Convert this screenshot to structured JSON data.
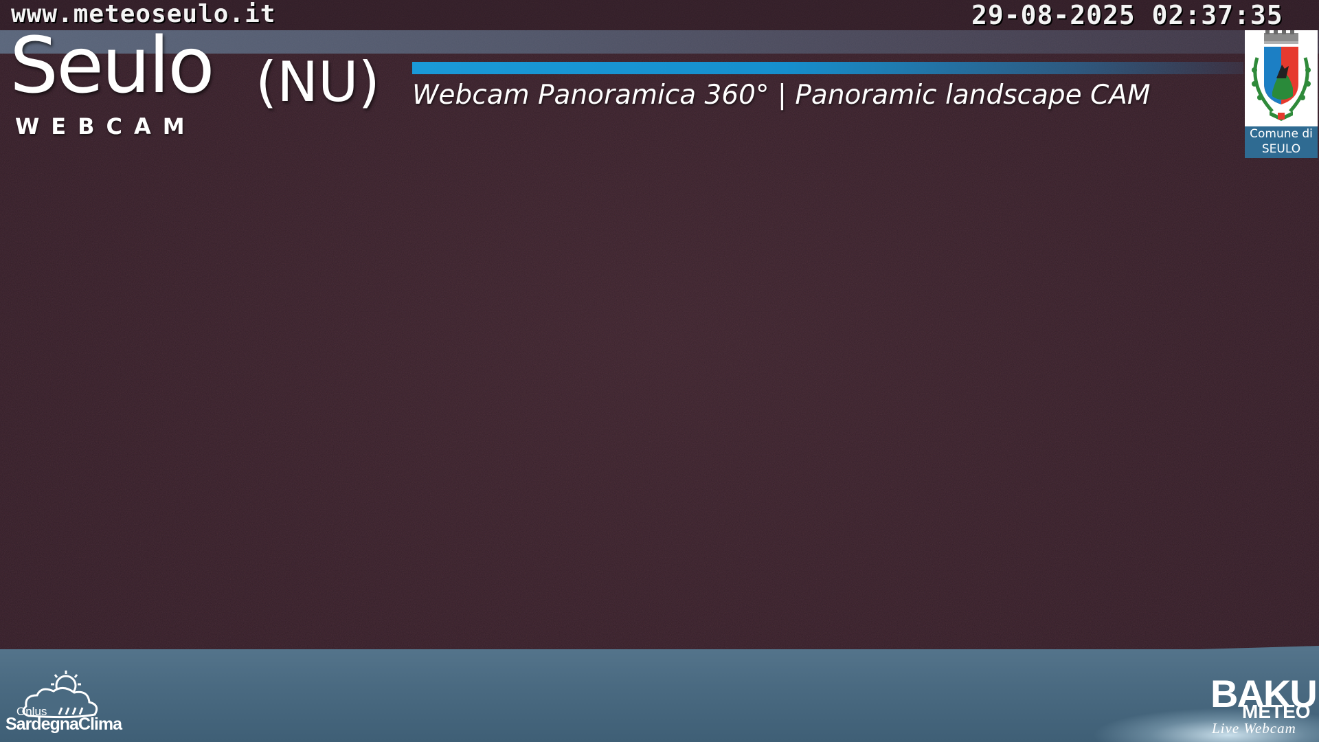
{
  "overlay": {
    "url": "www.meteoseulo.it",
    "timestamp": "29-08-2025 02:37:35",
    "town": "Seulo",
    "province": "(NU)",
    "label": "WEBCAM",
    "subtitle": "Webcam Panoramica 360°  |  Panoramic landscape CAM"
  },
  "crest": {
    "caption_line1": "Comune di",
    "caption_line2": "SEULO"
  },
  "logos": {
    "left": {
      "tag": "Onlus",
      "name": "SardegnaClima"
    },
    "right": {
      "main": "BAKU",
      "sub": "METEO",
      "tag": "Live Webcam"
    }
  },
  "colors": {
    "sky": "#352029",
    "accent_bar": "#1a9ad8",
    "ground_band": "#4a6a81",
    "crest_caption": "#2f6b92"
  }
}
